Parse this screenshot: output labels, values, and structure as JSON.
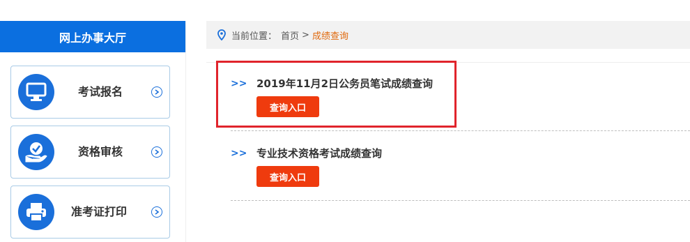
{
  "sidebar": {
    "title": "网上办事大厅",
    "items": [
      {
        "label": "考试报名",
        "icon": "monitor-icon"
      },
      {
        "label": "资格审核",
        "icon": "verified-hand-icon"
      },
      {
        "label": "准考证打印",
        "icon": "printer-icon"
      }
    ]
  },
  "breadcrumb": {
    "prefix": "当前位置：",
    "home": "首页",
    "separator": ">",
    "current": "成绩查询"
  },
  "exams": [
    {
      "marker": ">>",
      "title": "2019年11月2日公务员笔试成绩查询",
      "button": "查询入口"
    },
    {
      "marker": ">>",
      "title": "专业技术资格考试成绩查询",
      "button": "查询入口"
    }
  ],
  "colors": {
    "primary_blue": "#0b6fe0",
    "accent_orange": "#e06a0f",
    "button_red": "#ef3b0e",
    "highlight_red": "#e0242c"
  }
}
